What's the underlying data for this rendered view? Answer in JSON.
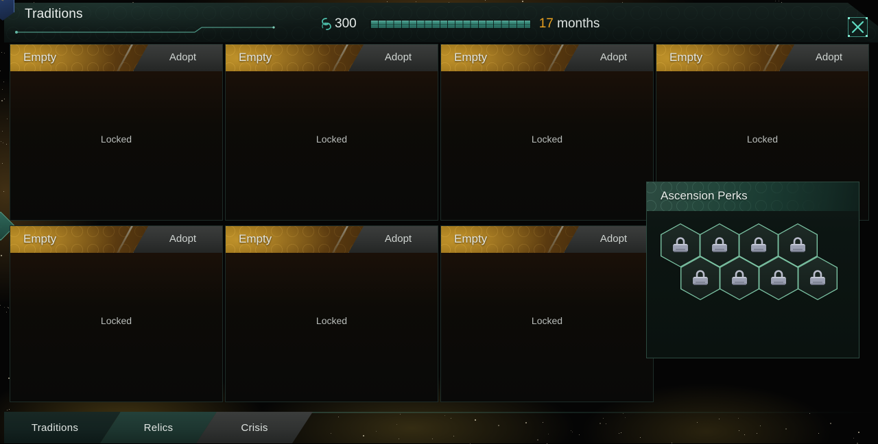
{
  "window": {
    "title": "Traditions",
    "emblem_icon": "empire-banner-icon",
    "close_icon": "close-x-icon"
  },
  "header": {
    "unity_icon": "unity-icon",
    "unity_value": "300",
    "progress": {
      "percent": 100,
      "segments": 21
    },
    "eta_number": "17",
    "eta_unit": "months"
  },
  "colors": {
    "accent_teal": "#4aa08f",
    "accent_amber": "#e8a020",
    "card_header_amber": "#8a6512",
    "perk_hex_border": "#7cc4a4",
    "panel_border": "#2d4a40"
  },
  "cards": [
    {
      "title": "Empty",
      "adopt_label": "Adopt",
      "body_status": "Locked"
    },
    {
      "title": "Empty",
      "adopt_label": "Adopt",
      "body_status": "Locked"
    },
    {
      "title": "Empty",
      "adopt_label": "Adopt",
      "body_status": "Locked"
    },
    {
      "title": "Empty",
      "adopt_label": "Adopt",
      "body_status": "Locked"
    },
    {
      "title": "Empty",
      "adopt_label": "Adopt",
      "body_status": "Locked"
    },
    {
      "title": "Empty",
      "adopt_label": "Adopt",
      "body_status": "Locked"
    },
    {
      "title": "Empty",
      "adopt_label": "Adopt",
      "body_status": "Locked"
    }
  ],
  "perks_panel": {
    "title": "Ascension Perks",
    "slots": [
      {
        "icon": "padlock-icon",
        "state": "locked"
      },
      {
        "icon": "padlock-icon",
        "state": "locked"
      },
      {
        "icon": "padlock-icon",
        "state": "locked"
      },
      {
        "icon": "padlock-icon",
        "state": "locked"
      },
      {
        "icon": "padlock-icon",
        "state": "locked"
      },
      {
        "icon": "padlock-icon",
        "state": "locked"
      },
      {
        "icon": "padlock-icon",
        "state": "locked"
      },
      {
        "icon": "padlock-icon",
        "state": "locked"
      }
    ]
  },
  "tabs": [
    {
      "label": "Traditions",
      "active": true
    },
    {
      "label": "Relics",
      "active": false
    },
    {
      "label": "Crisis",
      "active": false
    }
  ]
}
